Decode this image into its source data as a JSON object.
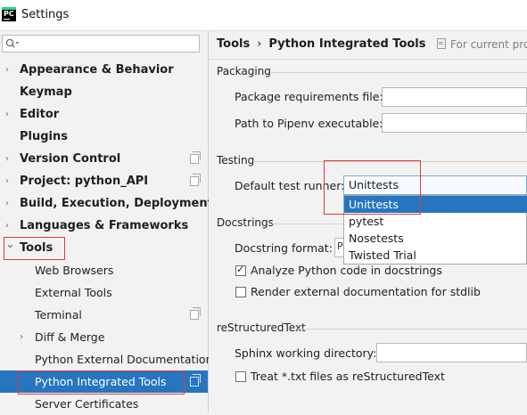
{
  "window": {
    "app_icon_text": "PC",
    "title": "Settings"
  },
  "search": {
    "placeholder": "",
    "icon": "search-icon"
  },
  "sidebar": {
    "items": [
      {
        "label": "Appearance & Behavior",
        "expandable": true,
        "expanded": false,
        "level": 0,
        "project_icon": false
      },
      {
        "label": "Keymap",
        "expandable": false,
        "level": 0,
        "project_icon": false
      },
      {
        "label": "Editor",
        "expandable": true,
        "expanded": false,
        "level": 0,
        "project_icon": false
      },
      {
        "label": "Plugins",
        "expandable": false,
        "level": 0,
        "project_icon": false
      },
      {
        "label": "Version Control",
        "expandable": true,
        "expanded": false,
        "level": 0,
        "project_icon": true
      },
      {
        "label": "Project: python_API",
        "expandable": true,
        "expanded": false,
        "level": 0,
        "project_icon": true
      },
      {
        "label": "Build, Execution, Deployment",
        "expandable": true,
        "expanded": false,
        "level": 0,
        "project_icon": false
      },
      {
        "label": "Languages & Frameworks",
        "expandable": true,
        "expanded": false,
        "level": 0,
        "project_icon": false
      },
      {
        "label": "Tools",
        "expandable": true,
        "expanded": true,
        "level": 0,
        "project_icon": false
      },
      {
        "label": "Web Browsers",
        "expandable": false,
        "level": 1,
        "project_icon": false
      },
      {
        "label": "External Tools",
        "expandable": false,
        "level": 1,
        "project_icon": false
      },
      {
        "label": "Terminal",
        "expandable": false,
        "level": 1,
        "project_icon": true
      },
      {
        "label": "Diff & Merge",
        "expandable": true,
        "expanded": false,
        "level": 1,
        "project_icon": false
      },
      {
        "label": "Python External Documentation",
        "expandable": false,
        "level": 1,
        "project_icon": false
      },
      {
        "label": "Python Integrated Tools",
        "expandable": false,
        "level": 1,
        "project_icon": true,
        "selected": true
      },
      {
        "label": "Server Certificates",
        "expandable": false,
        "level": 1,
        "project_icon": false
      }
    ]
  },
  "breadcrumb": {
    "parent": "Tools",
    "separator": "›",
    "current": "Python Integrated Tools",
    "scope_note": "For current pro"
  },
  "packaging": {
    "section": "Packaging",
    "requirements_label": "Package requirements file:",
    "requirements_value": "",
    "pipenv_label": "Path to Pipenv executable:",
    "pipenv_value": ""
  },
  "testing": {
    "section": "Testing",
    "runner_label": "Default test runner:",
    "runner_value": "Unittests",
    "runner_options": [
      "Unittests",
      "pytest",
      "Nosetests",
      "Twisted Trial"
    ],
    "selected_option": "Unittests"
  },
  "docstrings": {
    "section": "Docstrings",
    "format_label": "Docstring format:",
    "format_value_visible": "P",
    "analyze_label": "Analyze Python code in docstrings",
    "analyze_checked": true,
    "render_label": "Render external documentation for stdlib",
    "render_checked": false
  },
  "rest": {
    "section": "reStructuredText",
    "sphinx_label": "Sphinx working directory:",
    "sphinx_value": "",
    "treat_txt_label": "Treat *.txt files as reStructuredText",
    "treat_txt_checked": false
  },
  "colors": {
    "selection": "#2675bf",
    "highlight_box": "#e53935",
    "background": "#f2f2f2"
  }
}
